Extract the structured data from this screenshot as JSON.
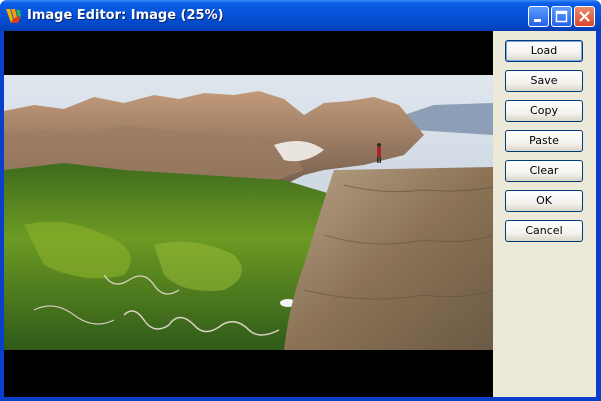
{
  "window": {
    "title": "Image Editor: Image (25%)",
    "title_icon": "app-logo-icon",
    "controls": [
      "minimize-icon",
      "maximize-icon",
      "close-icon"
    ],
    "colors": {
      "titlebar": "#0551d6",
      "face": "#ece9d8",
      "canvas": "#000000"
    }
  },
  "buttons": {
    "load": "Load",
    "save": "Save",
    "copy": "Copy",
    "paste": "Paste",
    "clear": "Clear",
    "ok": "OK",
    "cancel": "Cancel"
  },
  "image": {
    "description_icon": "landscape-photo"
  }
}
